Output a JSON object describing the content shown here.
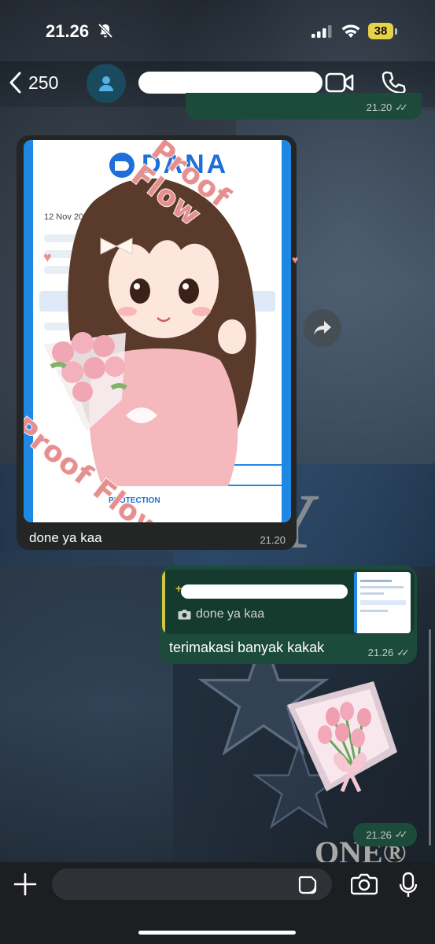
{
  "status_bar": {
    "time": "21.26",
    "battery": "38",
    "icons": [
      "bell-slash-icon",
      "cellular-signal-icon",
      "wifi-icon",
      "battery-icon"
    ]
  },
  "header": {
    "back_count": "250",
    "icons": [
      "chevron-left-icon",
      "person-icon",
      "video-icon",
      "phone-icon"
    ]
  },
  "messages": [
    {
      "id": "top-outgoing",
      "direction": "outgoing",
      "time": "21.20",
      "status": "read"
    },
    {
      "id": "incoming-image",
      "direction": "incoming",
      "image_text": {
        "logo": "DANA",
        "date": "12 Nov 2025",
        "protection": "PROTECTION",
        "sticker_text": "Proof Flow"
      },
      "caption": "done ya kaa",
      "time": "21.20"
    },
    {
      "id": "outgoing-reply",
      "direction": "outgoing",
      "quoted_text": "done ya kaa",
      "text": "terimakasi banyak kakak",
      "time": "21.26",
      "status": "read"
    },
    {
      "id": "outgoing-sticker",
      "direction": "outgoing",
      "sticker": "pink-tulip-bouquet",
      "time": "21.26",
      "status": "read"
    }
  ],
  "input_bar": {
    "placeholder": "",
    "icons": [
      "plus-icon",
      "sticker-icon",
      "camera-icon",
      "microphone-icon"
    ]
  },
  "wallpaper_text": {
    "large": "HY",
    "small": "ONE®"
  },
  "colors": {
    "outgoing_bubble": "#1d4b3b",
    "incoming_bubble": "#242626",
    "quote_accent": "#d4c24b",
    "dana_blue": "#1e88e5",
    "sticker_pink": "#e58f8f"
  }
}
